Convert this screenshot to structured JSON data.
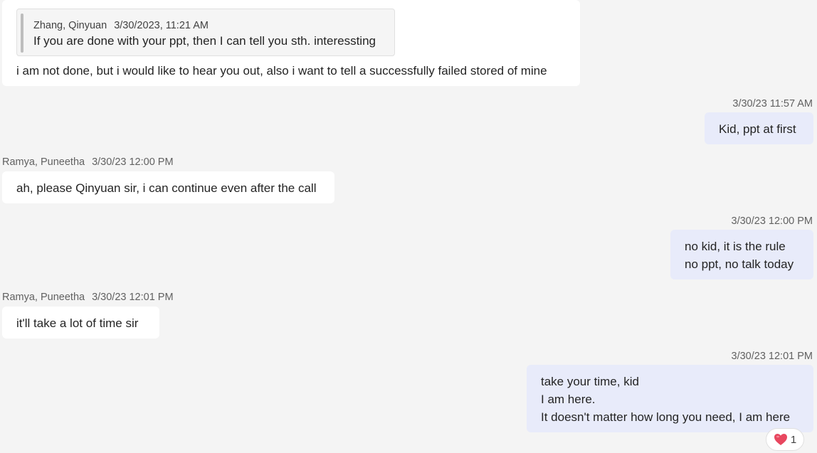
{
  "messages": [
    {
      "quote": {
        "author": "Zhang, Qinyuan",
        "time": "3/30/2023, 11:21 AM",
        "text": "If you are done with your ppt, then I can tell you sth. interessting"
      },
      "text": "i am not done, but i would like to hear you out, also i want to tell a successfully failed stored of mine"
    },
    {
      "time": "3/30/23 11:57 AM",
      "lines": [
        "Kid, ppt at first"
      ]
    },
    {
      "author": "Ramya, Puneetha",
      "time": "3/30/23 12:00 PM",
      "text": "ah, please Qinyuan sir, i can continue even after the call"
    },
    {
      "time": "3/30/23 12:00 PM",
      "lines": [
        "no kid, it is the rule",
        "no ppt, no talk today"
      ]
    },
    {
      "author": "Ramya, Puneetha",
      "time": "3/30/23 12:01 PM",
      "text": "it'll take a lot of time sir"
    },
    {
      "time": "3/30/23 12:01 PM",
      "lines": [
        "take your time, kid",
        "I am here.",
        "It doesn't matter how long you need, I am here"
      ],
      "reaction": {
        "icon": "heart-icon",
        "count": "1"
      }
    }
  ],
  "colors": {
    "background": "#f4f4f4",
    "incoming_bubble": "#ffffff",
    "outgoing_bubble": "#e8ebfa",
    "heart": "#e8475f"
  }
}
